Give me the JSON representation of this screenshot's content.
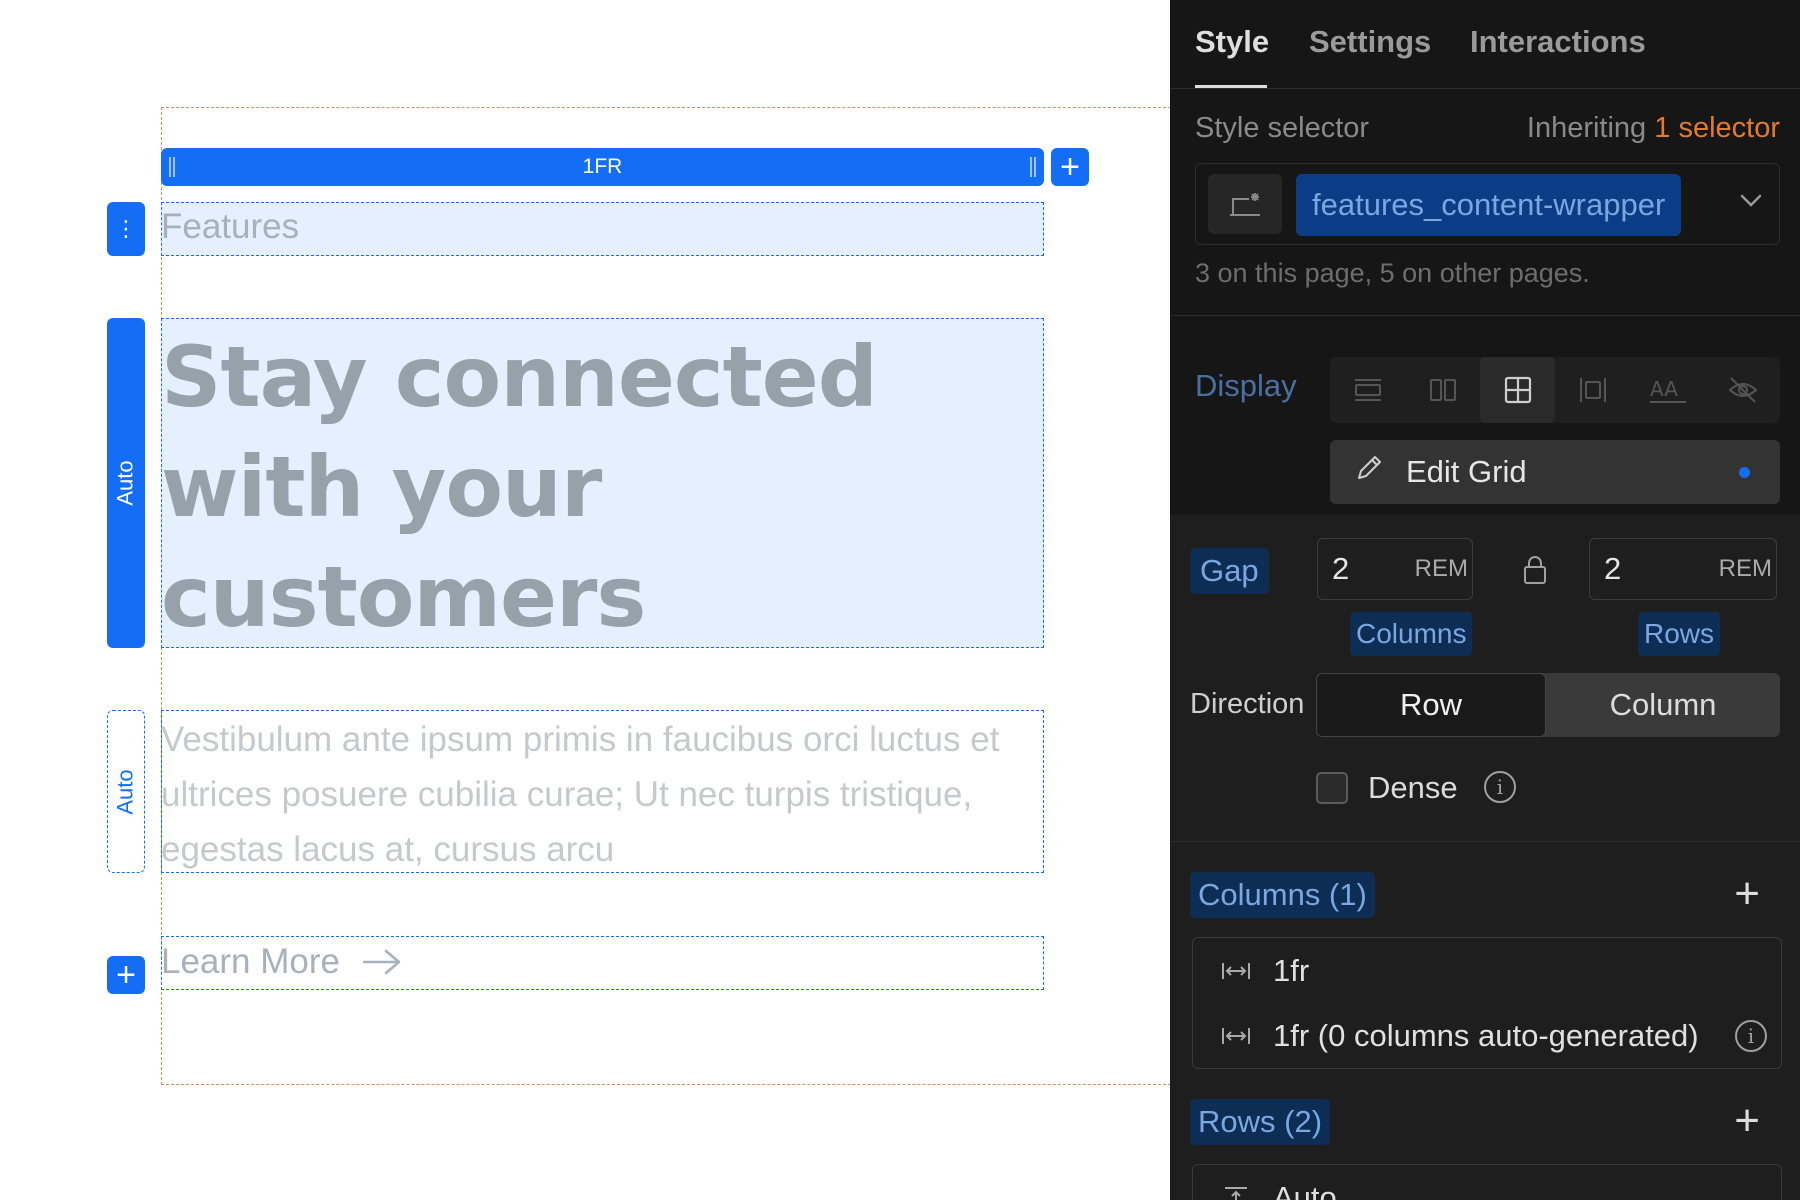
{
  "canvas": {
    "column_track_label": "1FR",
    "row_handles": [
      "Auto",
      "Auto"
    ],
    "features_label": "Features",
    "headline": "Stay connected with your customers",
    "paragraph": "Vestibulum ante ipsum primis in faucibus orci luctus et ultrices posuere cubilia curae; Ut nec turpis tristique, egestas lacus at, cursus arcu",
    "learn_more": "Learn More"
  },
  "panel": {
    "tabs": [
      {
        "label": "Style",
        "active": true
      },
      {
        "label": "Settings",
        "active": false
      },
      {
        "label": "Interactions",
        "active": false
      }
    ],
    "style_selector": {
      "label": "Style selector",
      "inheriting_prefix": "Inheriting",
      "inheriting_count": "1 selector",
      "class_name": "features_content-wrapper",
      "usage_note": "3 on this page, 5 on other pages."
    },
    "display": {
      "label": "Display",
      "options": [
        "block",
        "flex",
        "grid",
        "inline-block",
        "inline",
        "none"
      ],
      "selected": "grid"
    },
    "edit_grid_label": "Edit Grid",
    "gap": {
      "label": "Gap",
      "columns_value": "2",
      "rows_value": "2",
      "unit": "REM",
      "columns_label": "Columns",
      "rows_label": "Rows"
    },
    "direction": {
      "label": "Direction",
      "options": [
        "Row",
        "Column"
      ],
      "selected": "Row"
    },
    "dense_label": "Dense",
    "columns": {
      "header": "Columns (1)",
      "items": [
        "1fr",
        "1fr (0 columns auto-generated)"
      ]
    },
    "rows": {
      "header": "Rows (2)",
      "items": [
        "Auto"
      ]
    }
  },
  "colors": {
    "accent_blue": "#146ef5",
    "panel_bg": "#1e1e1e",
    "inherit_orange": "#e27b2d"
  }
}
